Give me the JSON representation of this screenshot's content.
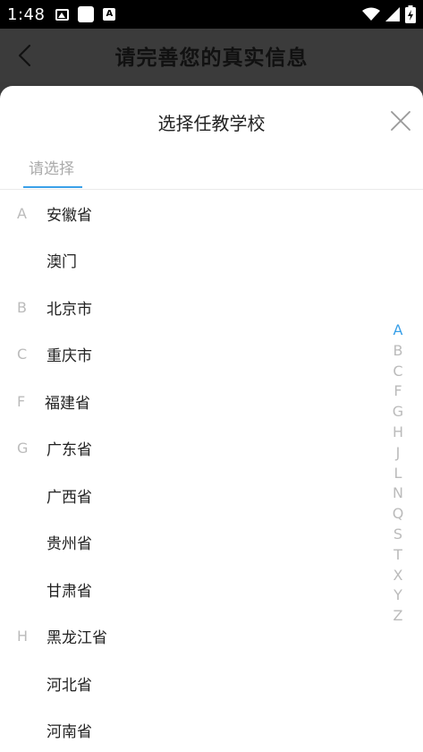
{
  "status_bar": {
    "time": "1:48"
  },
  "header": {
    "title": "请完善您的真实信息"
  },
  "sheet": {
    "title": "选择任教学校",
    "tab_label": "请选择"
  },
  "list": [
    {
      "letter": "A",
      "name": "安徽省"
    },
    {
      "letter": "",
      "name": "澳门"
    },
    {
      "letter": "B",
      "name": "北京市"
    },
    {
      "letter": "C",
      "name": "重庆市"
    },
    {
      "letter": "F",
      "name": "福建省"
    },
    {
      "letter": "G",
      "name": "广东省"
    },
    {
      "letter": "",
      "name": "广西省"
    },
    {
      "letter": "",
      "name": "贵州省"
    },
    {
      "letter": "",
      "name": "甘肃省"
    },
    {
      "letter": "H",
      "name": "黑龙江省"
    },
    {
      "letter": "",
      "name": "河北省"
    },
    {
      "letter": "",
      "name": "河南省"
    }
  ],
  "index_letters": [
    "A",
    "B",
    "C",
    "F",
    "G",
    "H",
    "J",
    "L",
    "N",
    "Q",
    "S",
    "T",
    "X",
    "Y",
    "Z"
  ],
  "active_index": "A",
  "colors": {
    "accent": "#3aa0e8",
    "header_bg": "#3b3b3b"
  }
}
